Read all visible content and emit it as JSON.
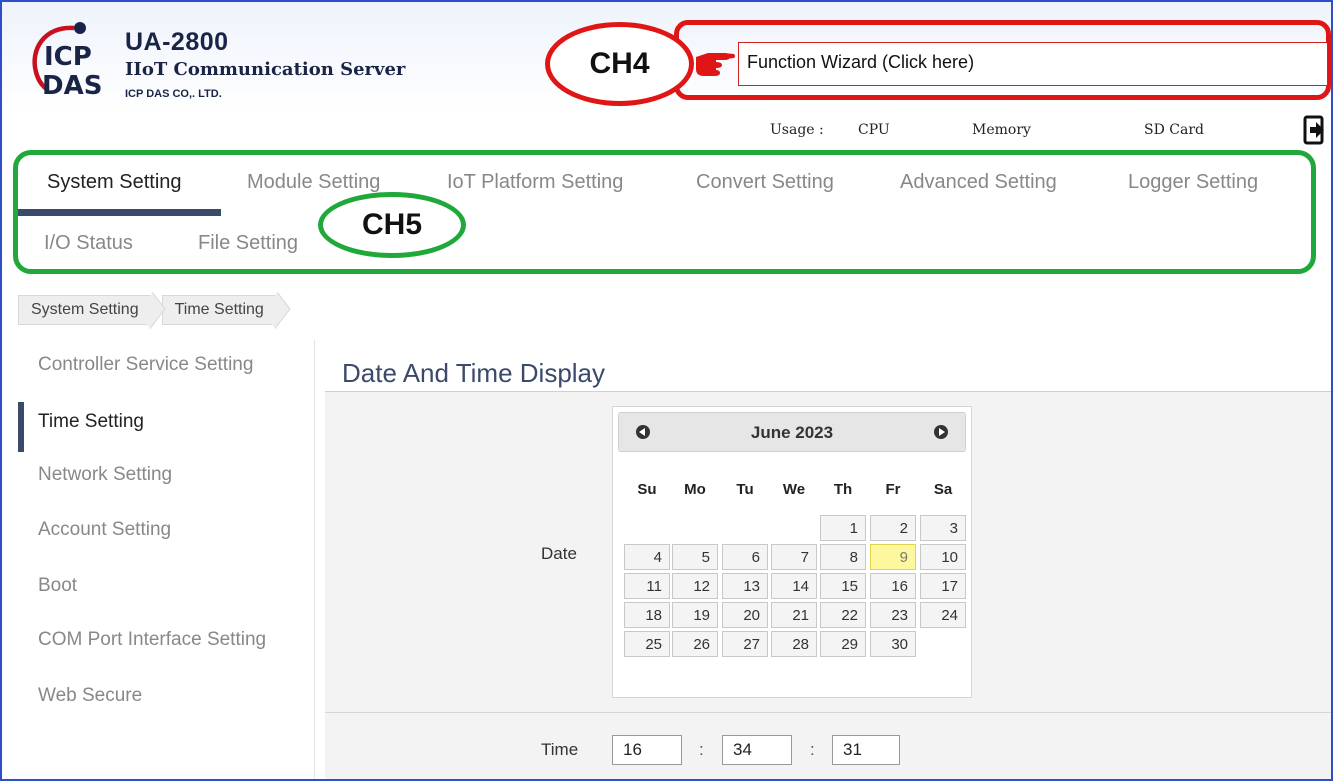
{
  "header": {
    "product": "UA-2800",
    "tagline": "IIoT Communication Server",
    "company": "ICP DAS CO,. LTD.",
    "logo_line1": "ICP",
    "logo_line2": "DAS",
    "wizard_label": "Function Wizard  (Click here)",
    "usage_label": "Usage :",
    "cpu_label": "CPU",
    "memory_label": "Memory",
    "sd_label": "SD Card"
  },
  "annotations": {
    "ch4": "CH4",
    "ch5": "CH5",
    "ch4_color": "#e01515",
    "ch5_color": "#21a83a"
  },
  "nav": {
    "tabs": [
      {
        "label": "System Setting"
      },
      {
        "label": "Module Setting"
      },
      {
        "label": "IoT Platform Setting"
      },
      {
        "label": "Convert Setting"
      },
      {
        "label": "Advanced Setting"
      },
      {
        "label": "Logger Setting"
      },
      {
        "label": "I/O Status"
      },
      {
        "label": "File Setting"
      }
    ]
  },
  "breadcrumb": [
    "System Setting",
    "Time Setting"
  ],
  "sidebar": {
    "items": [
      {
        "label": "Controller Service Setting"
      },
      {
        "label": "Time Setting"
      },
      {
        "label": "Network Setting"
      },
      {
        "label": "Account Setting"
      },
      {
        "label": "Boot"
      },
      {
        "label": "COM Port Interface Setting"
      },
      {
        "label": "Web Secure"
      }
    ]
  },
  "main": {
    "heading": "Date And Time Display",
    "date_label": "Date",
    "time_label": "Time",
    "calendar": {
      "title": "June 2023",
      "weekdays": [
        "Su",
        "Mo",
        "Tu",
        "We",
        "Th",
        "Fr",
        "Sa"
      ],
      "days": [
        "1",
        "2",
        "3",
        "4",
        "5",
        "6",
        "7",
        "8",
        "9",
        "10",
        "11",
        "12",
        "13",
        "14",
        "15",
        "16",
        "17",
        "18",
        "19",
        "20",
        "21",
        "22",
        "23",
        "24",
        "25",
        "26",
        "27",
        "28",
        "29",
        "30"
      ],
      "today": "9"
    },
    "time": {
      "hour": "16",
      "minute": "34",
      "second": "31",
      "separator": ":"
    }
  },
  "colors": {
    "accent": "#3b4a6b",
    "frame": "#2e4fc7",
    "today": "#fdf8a0"
  }
}
